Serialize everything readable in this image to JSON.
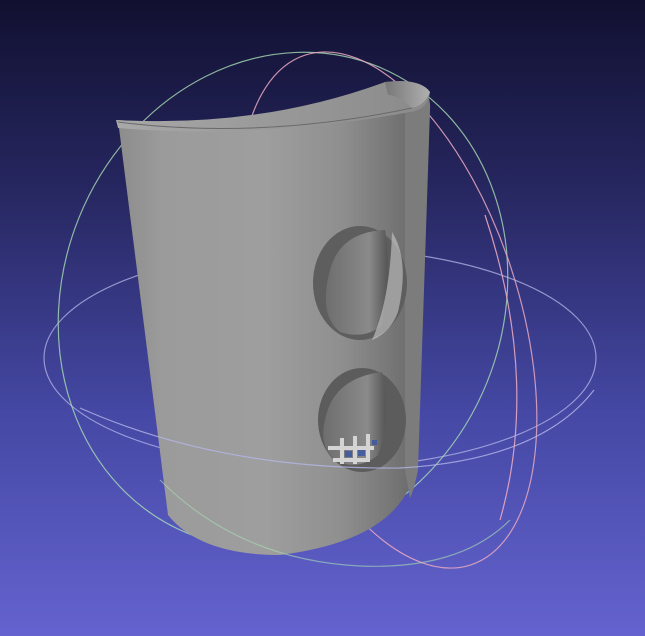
{
  "viewer": {
    "background_top": "#111030",
    "background_bottom": "#6463cf",
    "model_color": "#9a9a9a",
    "trackball": {
      "horizontal_ring_color": "#b4b6e8",
      "vertical_ring_a_color": "#a8dcb4",
      "vertical_ring_b_color": "#e8a8c0"
    }
  },
  "model": {
    "shape": "half-cylinder-cup",
    "holes": 2
  }
}
